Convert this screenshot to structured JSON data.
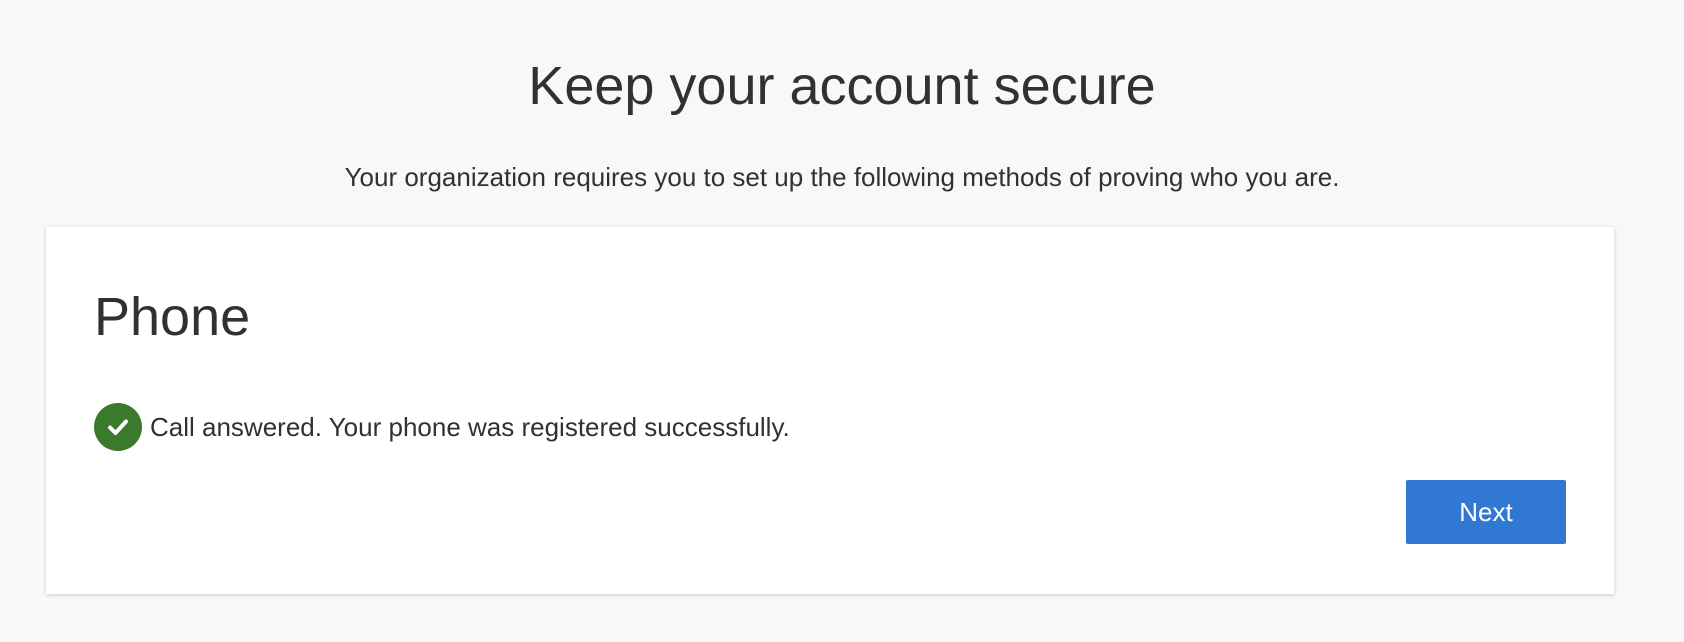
{
  "page": {
    "title": "Keep your account secure",
    "subtitle": "Your organization requires you to set up the following methods of proving who you are."
  },
  "card": {
    "title": "Phone",
    "status": {
      "icon": "checkmark-circle-icon",
      "message": "Call answered. Your phone was registered successfully."
    },
    "next_label": "Next"
  },
  "colors": {
    "background": "#f8f8f8",
    "card": "#ffffff",
    "text": "#323130",
    "success": "#3a7a2a",
    "primary_button": "#3078d1"
  }
}
